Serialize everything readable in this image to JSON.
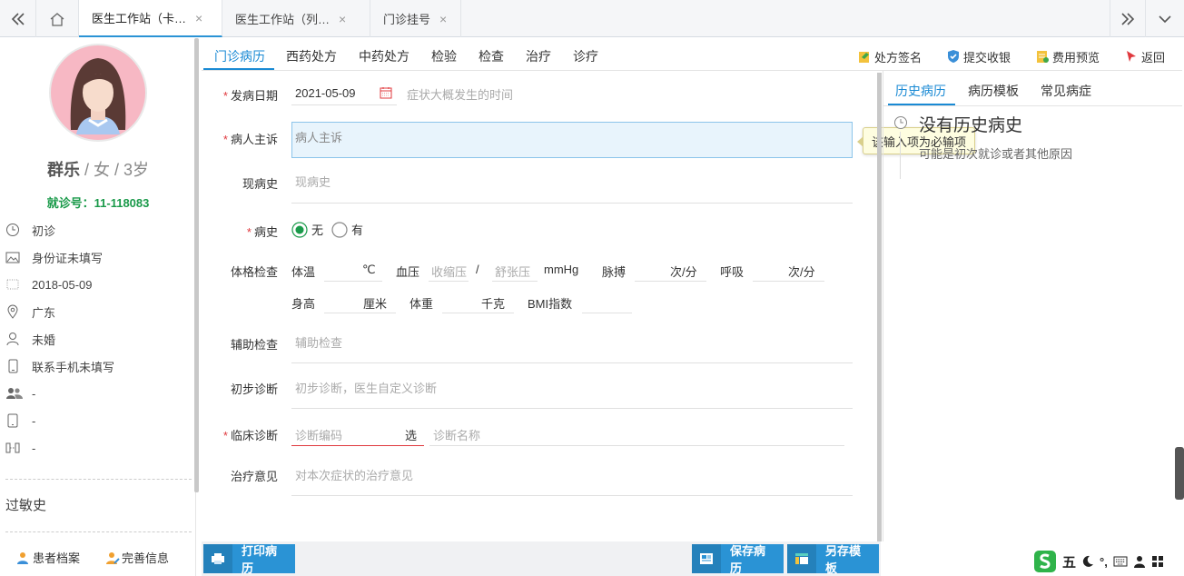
{
  "tabs": [
    {
      "label": "医生工作站（卡…",
      "active": true
    },
    {
      "label": "医生工作站（列…",
      "active": false
    },
    {
      "label": "门诊挂号",
      "active": false
    }
  ],
  "tab_close": "×",
  "patient": {
    "name": "群乐",
    "gender_age": " / 女 / 3岁",
    "visit_no": "就诊号：11-118083",
    "info": [
      "初诊",
      "身份证未填写",
      "2018-05-09",
      "广东",
      "未婚",
      "联系手机未填写",
      "-",
      "-",
      "-"
    ],
    "allergy_title": "过敏史",
    "footer_buttons": [
      "患者档案",
      "完善信息"
    ]
  },
  "subtabs": [
    "门诊病历",
    "西药处方",
    "中药处方",
    "检验",
    "检查",
    "治疗",
    "诊疗"
  ],
  "actions": [
    "处方签名",
    "提交收银",
    "费用预览",
    "返回"
  ],
  "form": {
    "onset_label": "发病日期",
    "onset_value": "2021-05-09",
    "onset_hint": "症状大概发生的时间",
    "complaint_label": "病人主诉",
    "complaint_placeholder": "病人主诉",
    "tooltip": "该输入项为必输项",
    "present_label": "现病史",
    "present_placeholder": "现病史",
    "history_label": "病史",
    "history_options": [
      "无",
      "有"
    ],
    "physical_label": "体格检查",
    "temp_label": "体温",
    "temp_unit": "℃",
    "bp_label": "血压",
    "bp_sys": "收缩压",
    "bp_sep": "/",
    "bp_dia": "舒张压",
    "bp_unit": "mmHg",
    "pulse_label": "脉搏",
    "pulse_unit": "次/分",
    "resp_label": "呼吸",
    "resp_unit": "次/分",
    "height_label": "身高",
    "height_unit": "厘米",
    "weight_label": "体重",
    "weight_unit": "千克",
    "bmi_label": "BMI指数",
    "aux_label": "辅助检查",
    "aux_placeholder": "辅助检查",
    "prelim_label": "初步诊断",
    "prelim_placeholder": "初步诊断，医生自定义诊断",
    "clinical_label": "临床诊断",
    "clinical_code_placeholder": "诊断编码",
    "clinical_select": "选",
    "clinical_name_placeholder": "诊断名称",
    "treat_label": "治疗意见",
    "treat_placeholder": "对本次症状的治疗意见"
  },
  "right": {
    "tabs": [
      "历史病历",
      "病历模板",
      "常见病症"
    ],
    "empty_title": "没有历史病史",
    "empty_sub": "可能是初次就诊或者其他原因"
  },
  "bottom": {
    "print": "打印病历",
    "save": "保存病历",
    "save_as": "另存模板"
  },
  "ime": {
    "label": "五",
    "punct": "°,"
  },
  "colors": {
    "accent": "#1a8ad4",
    "button": "#2a93d5",
    "visit_no": "#1a9a4a",
    "required": "#e0393e"
  }
}
